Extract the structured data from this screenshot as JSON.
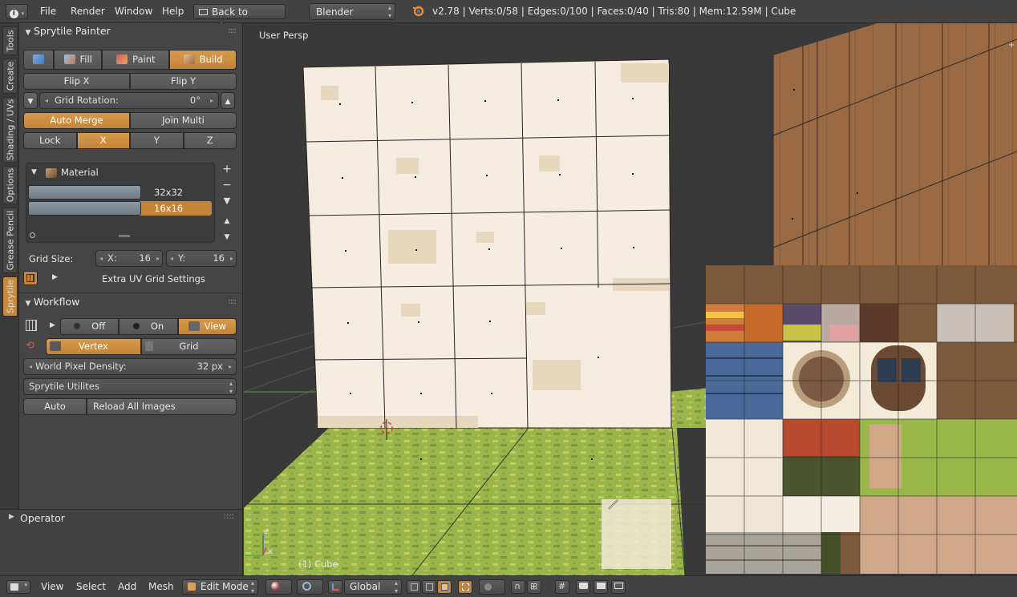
{
  "topbar": {
    "menus": [
      "File",
      "Render",
      "Window",
      "Help"
    ],
    "back_label": "Back to Previous",
    "engine": "Blender Render",
    "stats": "v2.78 | Verts:0/58 | Edges:0/100 | Faces:0/40 | Tris:80 | Mem:12.59M | Cube"
  },
  "vtabs": [
    "Tools",
    "Create",
    "Shading / UVs",
    "Options",
    "Grease Pencil",
    "Sprytile"
  ],
  "painter": {
    "title": "Sprytile Painter",
    "modes": [
      "Fill",
      "Paint",
      "Build"
    ],
    "flip_x": "Flip X",
    "flip_y": "Flip Y",
    "grid_rotation_label": "Grid Rotation:",
    "grid_rotation_value": "0°",
    "auto_merge": "Auto Merge",
    "join_multi": "Join Multi",
    "lock": "Lock",
    "axes": [
      "X",
      "Y",
      "Z"
    ],
    "material_label": "Material",
    "grid_items": [
      "32x32",
      "16x16"
    ],
    "grid_size_label": "Grid Size:",
    "grid_x_label": "X:",
    "grid_x_value": "16",
    "grid_y_label": "Y:",
    "grid_y_value": "16",
    "extra_uv": "Extra UV Grid Settings"
  },
  "workflow": {
    "title": "Workflow",
    "off": "Off",
    "on": "On",
    "view": "View",
    "vertex": "Vertex",
    "grid": "Grid",
    "density_label": "World Pixel Density:",
    "density_value": "32 px",
    "utilities": "Sprytile Utilites",
    "auto": "Auto",
    "reload": "Reload All Images"
  },
  "operator": {
    "title": "Operator"
  },
  "viewport": {
    "label": "User Persp",
    "object_label": "(1) Cube",
    "axis_z": "z",
    "axis_x": "x"
  },
  "bottombar": {
    "menus": [
      "View",
      "Select",
      "Add",
      "Mesh"
    ],
    "mode": "Edit Mode",
    "orientation": "Global"
  },
  "colors": {
    "accent": "#d08f3f",
    "panel": "#454545",
    "viewport": "#393939"
  }
}
